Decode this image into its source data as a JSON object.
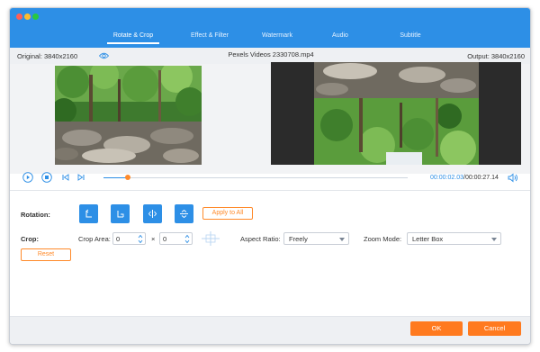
{
  "tabs": [
    {
      "label": "Rotate & Crop",
      "active": true
    },
    {
      "label": "Effect & Filter",
      "active": false
    },
    {
      "label": "Watermark",
      "active": false
    },
    {
      "label": "Audio",
      "active": false
    },
    {
      "label": "Subtitle",
      "active": false
    }
  ],
  "info": {
    "original": "Original: 3840x2160",
    "file_name": "Pexels Videos 2330708.mp4",
    "output": "Output: 3840x2160"
  },
  "playback": {
    "current_time": "00:00:02.03",
    "separator": "/",
    "total_time": "00:00:27.14",
    "progress": 0.08
  },
  "rotation": {
    "label": "Rotation:",
    "apply_label": "Apply to All"
  },
  "crop": {
    "label": "Crop:",
    "area_label": "Crop Area:",
    "width": "0",
    "times": "×",
    "height": "0",
    "aspect_label": "Aspect Ratio:",
    "aspect_value": "Freely",
    "zoom_label": "Zoom Mode:",
    "zoom_value": "Letter Box",
    "reset_label": "Reset"
  },
  "footer": {
    "ok_label": "OK",
    "cancel_label": "Cancel"
  },
  "colors": {
    "accent": "#2d8fe6",
    "orange": "#ff7a1f"
  }
}
